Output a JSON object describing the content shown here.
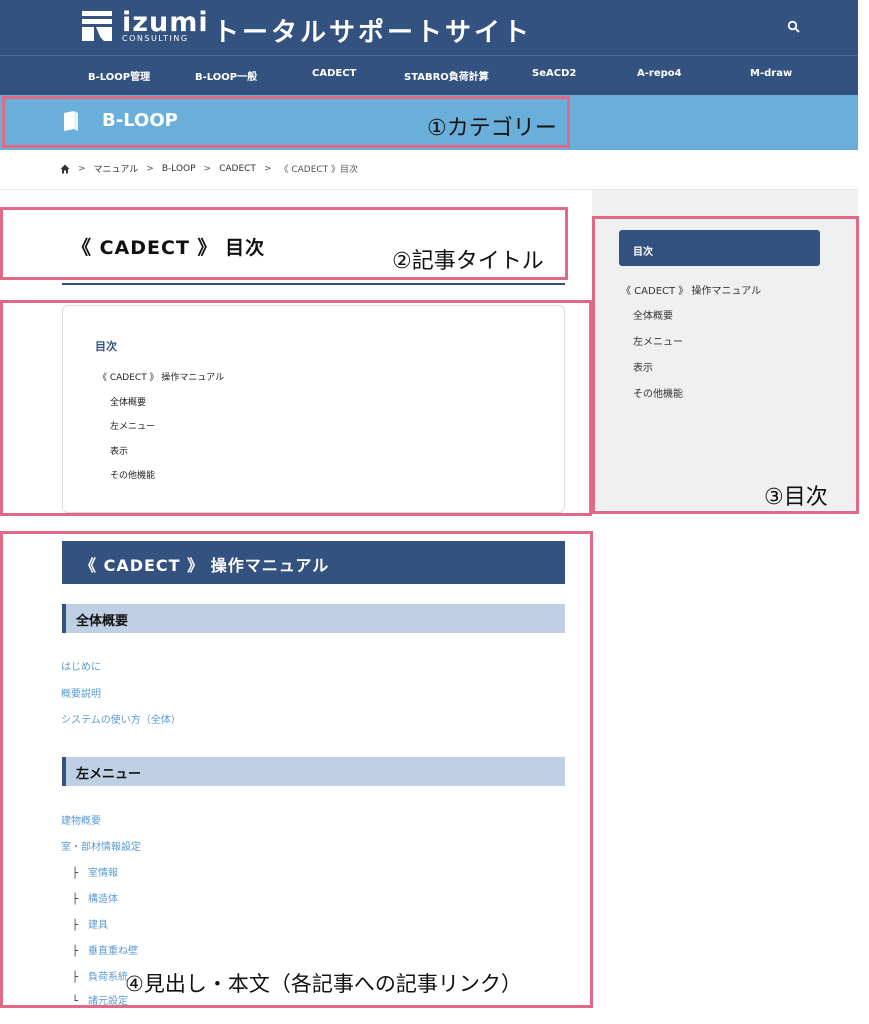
{
  "header": {
    "logo_word": "izumi",
    "logo_sub": "CONSULTING",
    "site_title": "トータルサポートサイト",
    "icons": {
      "search": "search-icon",
      "logo": "izumi-logo-icon"
    }
  },
  "nav": {
    "items": [
      {
        "label": "B-LOOP管理"
      },
      {
        "label": "B-LOOP一般"
      },
      {
        "label": "CADECT"
      },
      {
        "label": "STABRO負荷計算"
      },
      {
        "label": "SeACD2"
      },
      {
        "label": "A-repo4"
      },
      {
        "label": "M-draw"
      }
    ]
  },
  "category": {
    "name": "B-LOOP",
    "icon": "book-icon"
  },
  "breadcrumb": {
    "sep": ">",
    "items": [
      "マニュアル",
      "B-LOOP",
      "CADECT",
      "《 CADECT 》目次"
    ],
    "icon": "home-icon"
  },
  "article": {
    "title": "《  CADECT  》 目次"
  },
  "toc": {
    "heading": "目次",
    "items": [
      {
        "label": "《 CADECT 》 操作マニュアル"
      },
      {
        "label": "全体概要"
      },
      {
        "label": "左メニュー"
      },
      {
        "label": "表示"
      },
      {
        "label": "その他機能"
      }
    ]
  },
  "sidebar": {
    "heading": "目次",
    "items": [
      {
        "label": "《  CADECT  》 操作マニュアル"
      },
      {
        "label": "全体概要"
      },
      {
        "label": "左メニュー"
      },
      {
        "label": "表示"
      },
      {
        "label": "その他機能"
      }
    ]
  },
  "content": {
    "h2": "《  CADECT  》 操作マニュアル",
    "sections": [
      {
        "h3": "全体概要",
        "links": [
          "はじめに",
          "概要説明",
          "システムの使い方（全体）"
        ]
      },
      {
        "h3": "左メニュー",
        "links": [
          "建物概要",
          "室・部材情報設定"
        ],
        "tree_marks": [
          "├",
          "└"
        ],
        "sublinks": [
          "室情報",
          "構造体",
          "建具",
          "垂直重ね壁",
          "負荷系統",
          "諸元設定"
        ]
      }
    ]
  },
  "annotations": {
    "category": "①カテゴリー",
    "title": "②記事タイトル",
    "toc": "③目次",
    "body": "④見出し・本文（各記事への記事リンク）"
  },
  "colors": {
    "header_bg": "#34527f",
    "category_bg": "#6aafd9",
    "h3_bg": "#bfd0e5",
    "link": "#5b9bd1",
    "annotation_border": "#e06a86"
  }
}
